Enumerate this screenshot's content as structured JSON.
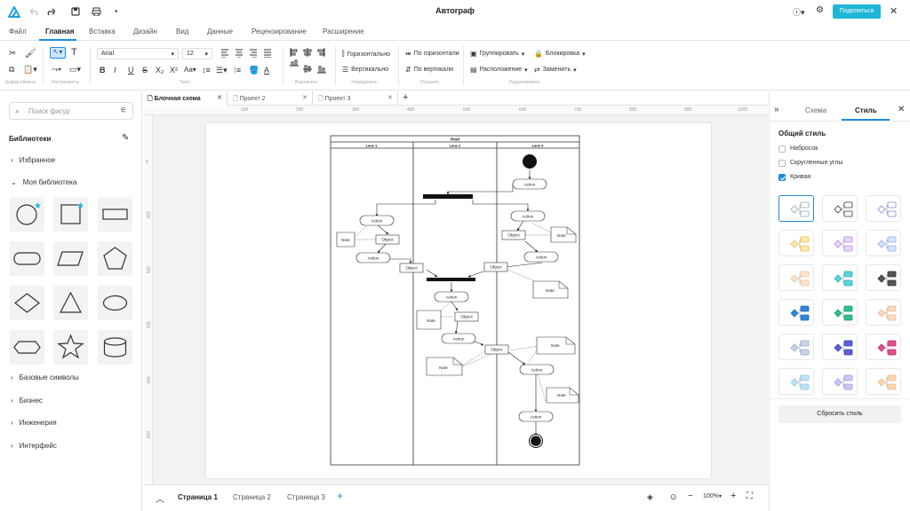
{
  "app": {
    "title": "Автограф",
    "share_label": "Поделиться"
  },
  "menu": {
    "tabs": [
      "Файл",
      "Главная",
      "Вставка",
      "Дизайн",
      "Вид",
      "Данные",
      "Рецензирование",
      "Расширение"
    ],
    "active": "Главная"
  },
  "ribbon": {
    "font_name": "Arial",
    "font_size": "12",
    "groups": [
      "Буфер обмена",
      "Инструменты",
      "Текст",
      "Выровнять",
      "Упорядочить",
      "Отразить",
      "Редактировать"
    ],
    "arrange": {
      "horizontal": "Горизонтально",
      "vertical": "Вертикально"
    },
    "flip": {
      "horizontal": "По горизонтали",
      "vertical": "По вертикали"
    },
    "edit": {
      "group": "Группировать",
      "lock": "Блокировка",
      "layout": "Расположение",
      "replace": "Заменить"
    }
  },
  "left": {
    "search_placeholder": "Поиск фигур",
    "libraries_title": "Библиотеки",
    "favorites": "Избранное",
    "my_library": "Моя библиотека",
    "categories": [
      "Базовые символы",
      "Бизнес",
      "Инженерия",
      "Интерфейс"
    ]
  },
  "doc_tabs": [
    "Блочная схема",
    "Проект 2",
    "Проект 3"
  ],
  "ruler": {
    "h": [
      "100",
      "200",
      "300",
      "400",
      "500",
      "600",
      "700",
      "800",
      "900",
      "1000"
    ],
    "v": [
      "0",
      "100",
      "200",
      "300",
      "400",
      "500"
    ]
  },
  "diagram": {
    "pool": "Pool",
    "lanes": [
      "Lane 1",
      "Lane 2",
      "Lane 3"
    ],
    "action": "Action",
    "object": "Object",
    "note": "Note"
  },
  "pages": {
    "tabs": [
      "Страница 1",
      "Страница 2",
      "Страница 3"
    ],
    "zoom": "100%"
  },
  "right": {
    "tabs": [
      "Схема",
      "Стиль"
    ],
    "general_style": "Общий стиль",
    "options": [
      {
        "label": "Набросок",
        "checked": false
      },
      {
        "label": "Скругленные углы",
        "checked": false
      },
      {
        "label": "Кривая",
        "checked": true
      }
    ],
    "reset_label": "Сбросить стиль"
  },
  "colors": {
    "accent": "#1f8be0",
    "share_bg": "#1fb5d6"
  }
}
